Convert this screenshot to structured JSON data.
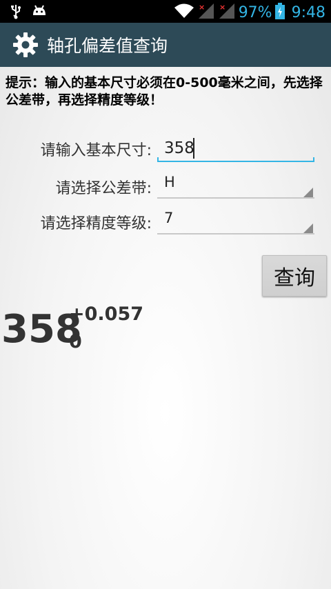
{
  "status_bar": {
    "battery_percent": "97%",
    "time": "9:48",
    "icons": [
      "usb-icon",
      "android-icon",
      "wifi-icon",
      "signal-icon",
      "signal-icon",
      "battery-icon"
    ]
  },
  "action_bar": {
    "title": "轴孔偏差值查询",
    "icon": "gear-icon",
    "background": "#2d4a57"
  },
  "hint": "提示：输入的基本尺寸必须在0-500毫米之间，先选择公差带，再选择精度等级！",
  "form": {
    "size_label": "请输入基本尺寸:",
    "size_value": "358",
    "tolerance_label": "请选择公差带:",
    "tolerance_value": "H",
    "grade_label": "请选择精度等级:",
    "grade_value": "7"
  },
  "query_button_label": "查询",
  "result": {
    "basic_size": "358",
    "upper_deviation": "+0.057",
    "lower_deviation": "0"
  },
  "colors": {
    "accent": "#33b5e5",
    "action_bar": "#2d4a57"
  }
}
